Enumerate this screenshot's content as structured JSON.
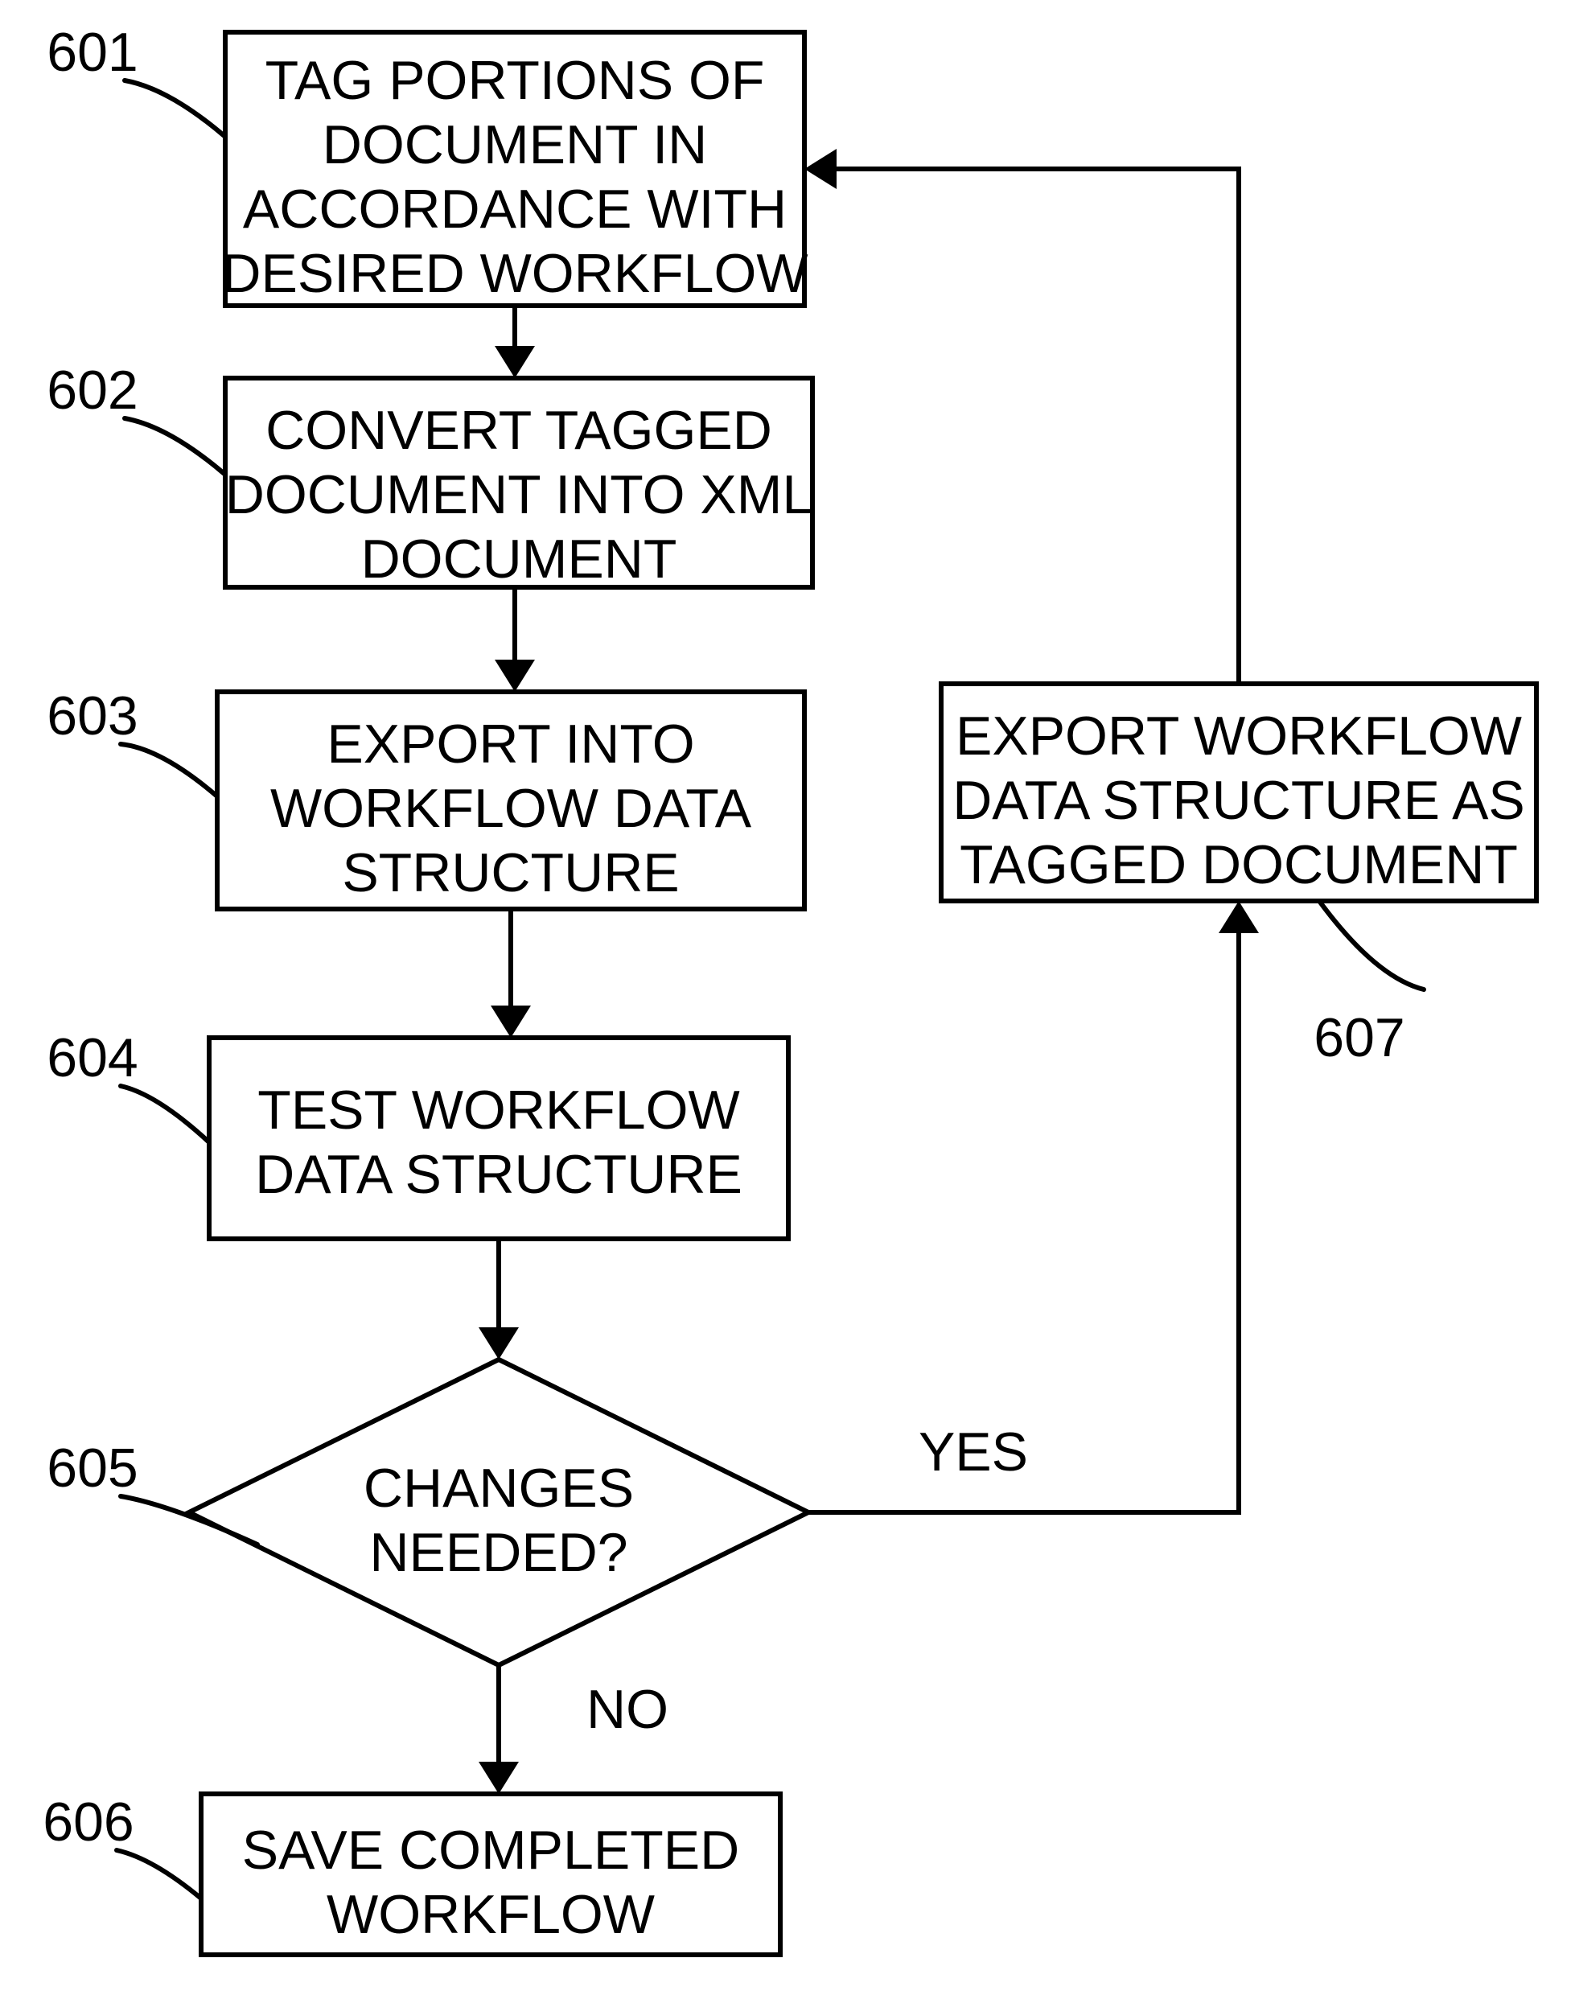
{
  "nodes": {
    "n601": {
      "num": "601",
      "lines": [
        "TAG PORTIONS OF",
        "DOCUMENT IN",
        "ACCORDANCE WITH",
        "DESIRED WORKFLOW"
      ]
    },
    "n602": {
      "num": "602",
      "lines": [
        "CONVERT TAGGED",
        "DOCUMENT INTO XML",
        "DOCUMENT"
      ]
    },
    "n603": {
      "num": "603",
      "lines": [
        "EXPORT INTO",
        "WORKFLOW DATA",
        "STRUCTURE"
      ]
    },
    "n604": {
      "num": "604",
      "lines": [
        "TEST WORKFLOW",
        "DATA STRUCTURE"
      ]
    },
    "n605": {
      "num": "605",
      "lines": [
        "CHANGES",
        "NEEDED?"
      ]
    },
    "n606": {
      "num": "606",
      "lines": [
        "SAVE COMPLETED",
        "WORKFLOW"
      ]
    },
    "n607": {
      "num": "607",
      "lines": [
        "EXPORT WORKFLOW",
        "DATA STRUCTURE AS",
        "TAGGED DOCUMENT"
      ]
    }
  },
  "edge_labels": {
    "yes": "YES",
    "no": "NO"
  }
}
